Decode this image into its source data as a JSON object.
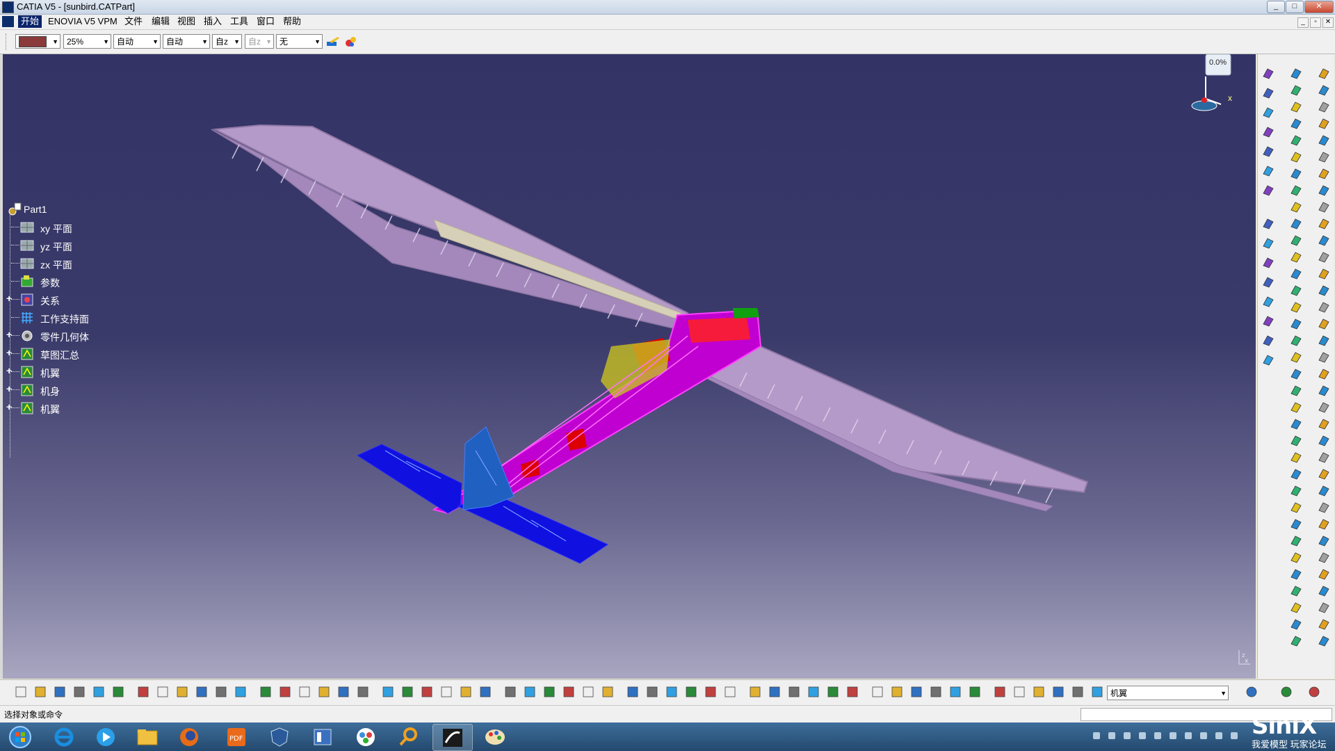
{
  "window": {
    "title": "CATIA V5 - [sunbird.CATPart]",
    "controls": [
      "_",
      "□",
      "✕"
    ],
    "mdi_controls": [
      "_",
      "▫",
      "✕"
    ]
  },
  "menu": {
    "items": [
      "开始",
      "ENOVIA V5 VPM",
      "文件",
      "编辑",
      "视图",
      "插入",
      "工具",
      "窗口",
      "帮助"
    ]
  },
  "graphic_properties": {
    "color": "#8a3a3a",
    "transparency": "25%",
    "line_thickness": "自动",
    "line_type": "自动",
    "point_symbol": "自z",
    "layer_disabled": "自z",
    "layer": "无"
  },
  "compass": {
    "label": "0.0%",
    "axis": "x"
  },
  "tree": {
    "root": "Part1",
    "items": [
      {
        "label": "xy 平面",
        "expandable": false,
        "icon": "plane-icon"
      },
      {
        "label": "yz 平面",
        "expandable": false,
        "icon": "plane-icon"
      },
      {
        "label": "zx 平面",
        "expandable": false,
        "icon": "plane-icon"
      },
      {
        "label": "参数",
        "expandable": false,
        "icon": "parameters-icon"
      },
      {
        "label": "关系",
        "expandable": true,
        "icon": "relations-icon"
      },
      {
        "label": "工作支持面",
        "expandable": false,
        "icon": "grid-icon"
      },
      {
        "label": "零件几何体",
        "expandable": true,
        "icon": "part-body-icon"
      },
      {
        "label": "草图汇总",
        "expandable": true,
        "icon": "geometrical-set-icon"
      },
      {
        "label": "机翼",
        "expandable": true,
        "icon": "geometrical-set-icon"
      },
      {
        "label": "机身",
        "expandable": true,
        "icon": "geometrical-set-icon"
      },
      {
        "label": "机翼",
        "expandable": true,
        "icon": "geometrical-set-icon"
      }
    ]
  },
  "bottom_toolbar": {
    "current_set": "机翼"
  },
  "status": {
    "prompt": "选择对象或命令"
  },
  "watermark": {
    "logo": "SiniX",
    "caption": "我爱模型 玩家论坛"
  },
  "colors": {
    "viewport_top": "#333366",
    "viewport_bottom": "#a8a6c0",
    "wing": "#b49ac8",
    "tail": "#1010e0",
    "fuselage": "#cc00cc"
  }
}
